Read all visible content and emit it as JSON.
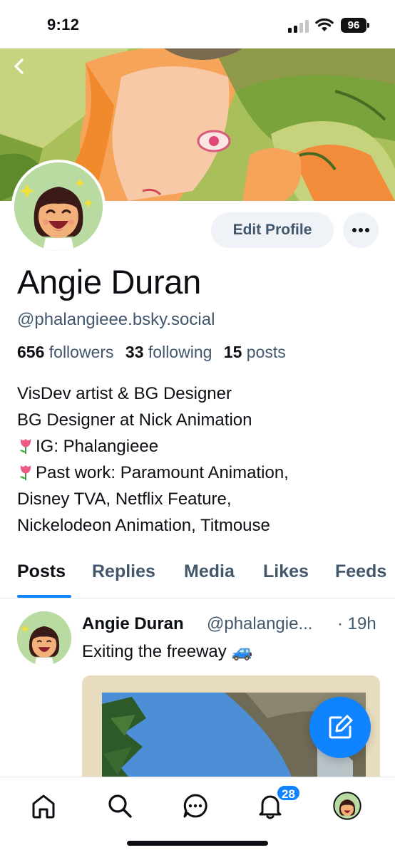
{
  "status_bar": {
    "time": "9:12",
    "battery": "96",
    "signal_icon": "cellular-signal-icon",
    "wifi_icon": "wifi-icon"
  },
  "header": {
    "back_icon": "chevron-left-icon"
  },
  "profile": {
    "display_name": "Angie Duran",
    "handle": "@phalangieee.bsky.social",
    "followers_count": "656",
    "followers_label": "followers",
    "following_count": "33",
    "following_label": "following",
    "posts_count": "15",
    "posts_label": "posts",
    "edit_button": "Edit Profile",
    "more_icon": "ellipsis-icon",
    "bio_lines": [
      "VisDev artist & BG Designer",
      "BG Designer at Nick Animation",
      "IG: Phalangieee",
      "Past work: Paramount Animation,",
      "Disney TVA, Netflix Feature,",
      "Nickelodeon Animation, Titmouse"
    ],
    "bio_emoji_icon": "tulip-icon"
  },
  "tabs": [
    {
      "label": "Posts",
      "active": true
    },
    {
      "label": "Replies",
      "active": false
    },
    {
      "label": "Media",
      "active": false
    },
    {
      "label": "Likes",
      "active": false
    },
    {
      "label": "Feeds",
      "active": false
    }
  ],
  "feed": [
    {
      "author": "Angie Duran",
      "handle": "@phalangie...",
      "time": "· 19h",
      "text": "Exiting the freeway 🚙",
      "has_image": true
    }
  ],
  "compose_icon": "compose-pencil-icon",
  "bottom_nav": {
    "items": [
      "home-icon",
      "search-icon",
      "chat-icon",
      "notifications-bell-icon",
      "profile-avatar"
    ],
    "notifications_badge": "28"
  },
  "colors": {
    "accent": "#1083fe",
    "secondary_text": "#42576c",
    "primary_text": "#0b0f14",
    "button_bg": "#eff2f6"
  }
}
